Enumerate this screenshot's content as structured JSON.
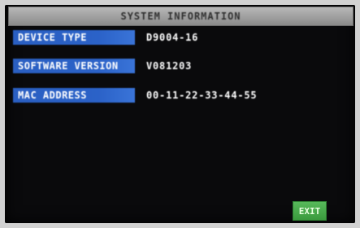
{
  "screen": {
    "title": "SYSTEM INFORMATION"
  },
  "info": {
    "device_type_label": "DEVICE TYPE",
    "device_type_value": "D9004-16",
    "software_version_label": "SOFTWARE VERSION",
    "software_version_value": "V081203",
    "mac_address_label": "MAC ADDRESS",
    "mac_address_value": "00-11-22-33-44-55"
  },
  "footer": {
    "exit_label": "EXIT"
  },
  "colors": {
    "label_bg": "#2b62c8",
    "title_bg": "#a0a0a0",
    "exit_bg": "#46a84a",
    "screen_bg": "#0a0a0c"
  }
}
